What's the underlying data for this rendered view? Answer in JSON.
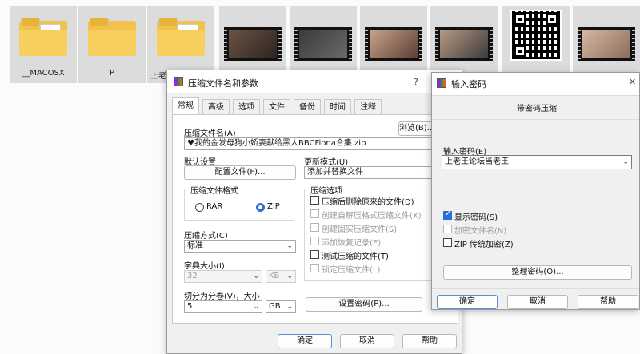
{
  "desktop": {
    "items": [
      {
        "label": "__MACOSX",
        "kind": "folder"
      },
      {
        "label": "P",
        "kind": "folder"
      },
      {
        "label": "上老王论坛当",
        "kind": "folder"
      },
      {
        "label": "",
        "kind": "video"
      },
      {
        "label": "",
        "kind": "video"
      },
      {
        "label": "",
        "kind": "video"
      },
      {
        "label": "",
        "kind": "video"
      },
      {
        "label": "",
        "kind": "qr"
      },
      {
        "label": "",
        "kind": "video"
      }
    ]
  },
  "archive_dialog": {
    "title": "压缩文件名和参数",
    "help": "?",
    "tabs": [
      "常规",
      "高级",
      "选项",
      "文件",
      "备份",
      "时间",
      "注释"
    ],
    "archive_name_label": "压缩文件名(A)",
    "archive_name_value": "♥我的金发母狗小娇妻献给黑人BBCFiona合集.zip",
    "browse_label": "浏览(B)...",
    "default_settings_label": "默认设置",
    "profiles_button": "配置文件(F)...",
    "update_mode_label": "更新模式(U)",
    "update_mode_value": "添加并替换文件",
    "format_group_label": "压缩文件格式",
    "format_rar": "RAR",
    "format_zip": "ZIP",
    "method_label": "压缩方式(C)",
    "method_value": "标准",
    "dict_label": "字典大小(I)",
    "dict_value": "32",
    "dict_unit": "KB",
    "split_label": "切分为分卷(V)，大小",
    "split_value": "5",
    "split_unit": "GB",
    "options_group_label": "压缩选项",
    "options": [
      {
        "label": "压缩后删除原来的文件(D)",
        "checked": false,
        "enabled": true
      },
      {
        "label": "创建自解压格式压缩文件(X)",
        "checked": false,
        "enabled": false
      },
      {
        "label": "创建固实压缩文件(S)",
        "checked": false,
        "enabled": false
      },
      {
        "label": "添加恢复记录(E)",
        "checked": false,
        "enabled": false
      },
      {
        "label": "测试压缩的文件(T)",
        "checked": false,
        "enabled": true
      },
      {
        "label": "锁定压缩文件(L)",
        "checked": false,
        "enabled": false
      }
    ],
    "set_password_button": "设置密码(P)...",
    "ok": "确定",
    "cancel": "取消",
    "help_button": "帮助"
  },
  "password_dialog": {
    "title": "输入密码",
    "close": "✕",
    "subtitle": "带密码压缩",
    "password_label": "输入密码(E)",
    "password_value": "上老王论坛当老王",
    "show_password": "显示密码(S)",
    "encrypt_names": "加密文件名(N)",
    "zip_legacy": "ZIP 传统加密(Z)",
    "organize_button": "整理密码(O)...",
    "ok": "确定",
    "cancel": "取消",
    "help_button": "帮助"
  },
  "colors": {
    "accent": "#2a6fd6",
    "folder": "#f2c24d"
  }
}
